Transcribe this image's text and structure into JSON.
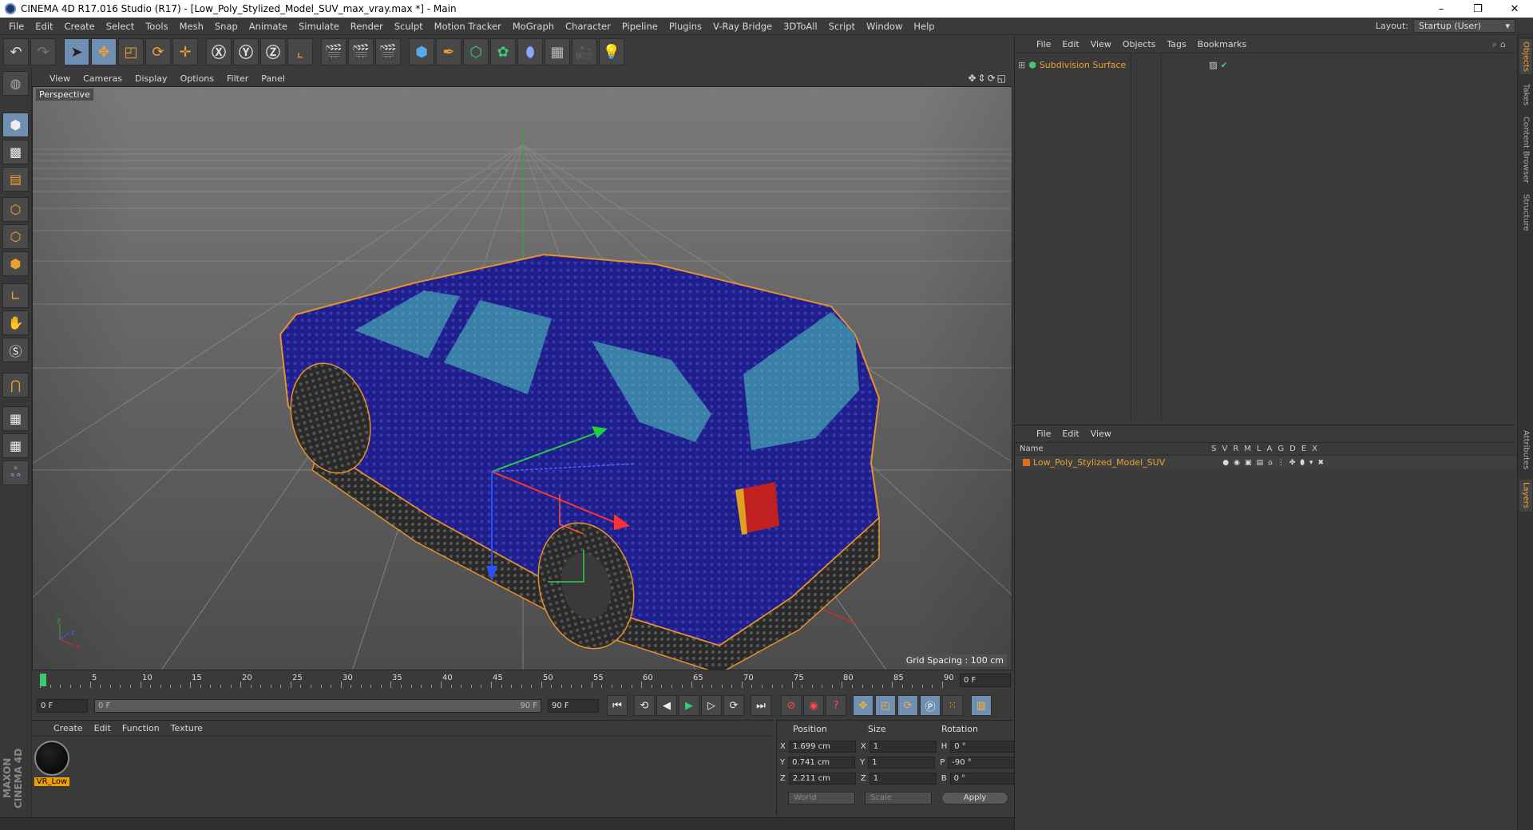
{
  "window": {
    "title": "CINEMA 4D R17.016 Studio (R17) - [Low_Poly_Stylized_Model_SUV_max_vray.max *] - Main",
    "minimize": "–",
    "maximize": "❐",
    "close": "✕"
  },
  "menu": [
    "File",
    "Edit",
    "Create",
    "Select",
    "Tools",
    "Mesh",
    "Snap",
    "Animate",
    "Simulate",
    "Render",
    "Sculpt",
    "Motion Tracker",
    "MoGraph",
    "Character",
    "Pipeline",
    "Plugins",
    "V-Ray Bridge",
    "3DToAll",
    "Script",
    "Window",
    "Help"
  ],
  "layout": {
    "label": "Layout:",
    "value": "Startup (User)"
  },
  "viewport": {
    "menu": [
      "View",
      "Cameras",
      "Display",
      "Options",
      "Filter",
      "Panel"
    ],
    "label": "Perspective",
    "grid_spacing": "Grid Spacing : 100 cm",
    "nav_icons": "✥⇕⟳◱"
  },
  "timeline": {
    "ticks": [
      "0",
      "5",
      "10",
      "15",
      "20",
      "25",
      "30",
      "35",
      "40",
      "45",
      "50",
      "55",
      "60",
      "65",
      "70",
      "75",
      "80",
      "85",
      "90"
    ],
    "current_frame": "0 F"
  },
  "playback": {
    "start": "0 F",
    "slider_start": "0 F",
    "slider_end": "90 F",
    "end": "90 F"
  },
  "materials": {
    "menu": [
      "Create",
      "Edit",
      "Function",
      "Texture"
    ],
    "items": [
      {
        "name": "VR_Low"
      }
    ]
  },
  "coordinates": {
    "headers": {
      "position": "Position",
      "size": "Size",
      "rotation": "Rotation"
    },
    "rows": [
      {
        "axis": "X",
        "pos": "1.699 cm",
        "size_axis": "X",
        "size": "1",
        "rot_axis": "H",
        "rot": "0 °"
      },
      {
        "axis": "Y",
        "pos": "0.741 cm",
        "size_axis": "Y",
        "size": "1",
        "rot_axis": "P",
        "rot": "-90 °"
      },
      {
        "axis": "Z",
        "pos": "2.211 cm",
        "size_axis": "Z",
        "size": "1",
        "rot_axis": "B",
        "rot": "0 °"
      }
    ],
    "space": "World",
    "mode": "Scale",
    "apply": "Apply"
  },
  "objects_panel": {
    "menu": [
      "File",
      "Edit",
      "View",
      "Objects",
      "Tags",
      "Bookmarks"
    ],
    "items": [
      {
        "name": "Subdivision Surface"
      }
    ]
  },
  "layers_panel": {
    "menu": [
      "File",
      "Edit",
      "View"
    ],
    "header_name": "Name",
    "columns": [
      "S",
      "V",
      "R",
      "M",
      "L",
      "A",
      "G",
      "D",
      "E",
      "X"
    ],
    "items": [
      {
        "name": "Low_Poly_Stylized_Model_SUV"
      }
    ]
  },
  "right_tabs": [
    "Objects",
    "Takes",
    "Content Browser",
    "Structure",
    "Attributes",
    "Layers"
  ],
  "maxon_logo": "MAXON CINEMA 4D",
  "colors": {
    "accent_orange": "#f0a030",
    "active_blue": "#6f8fb3",
    "car_body": "#1f1f8c",
    "car_glass": "#3a7fa8"
  }
}
